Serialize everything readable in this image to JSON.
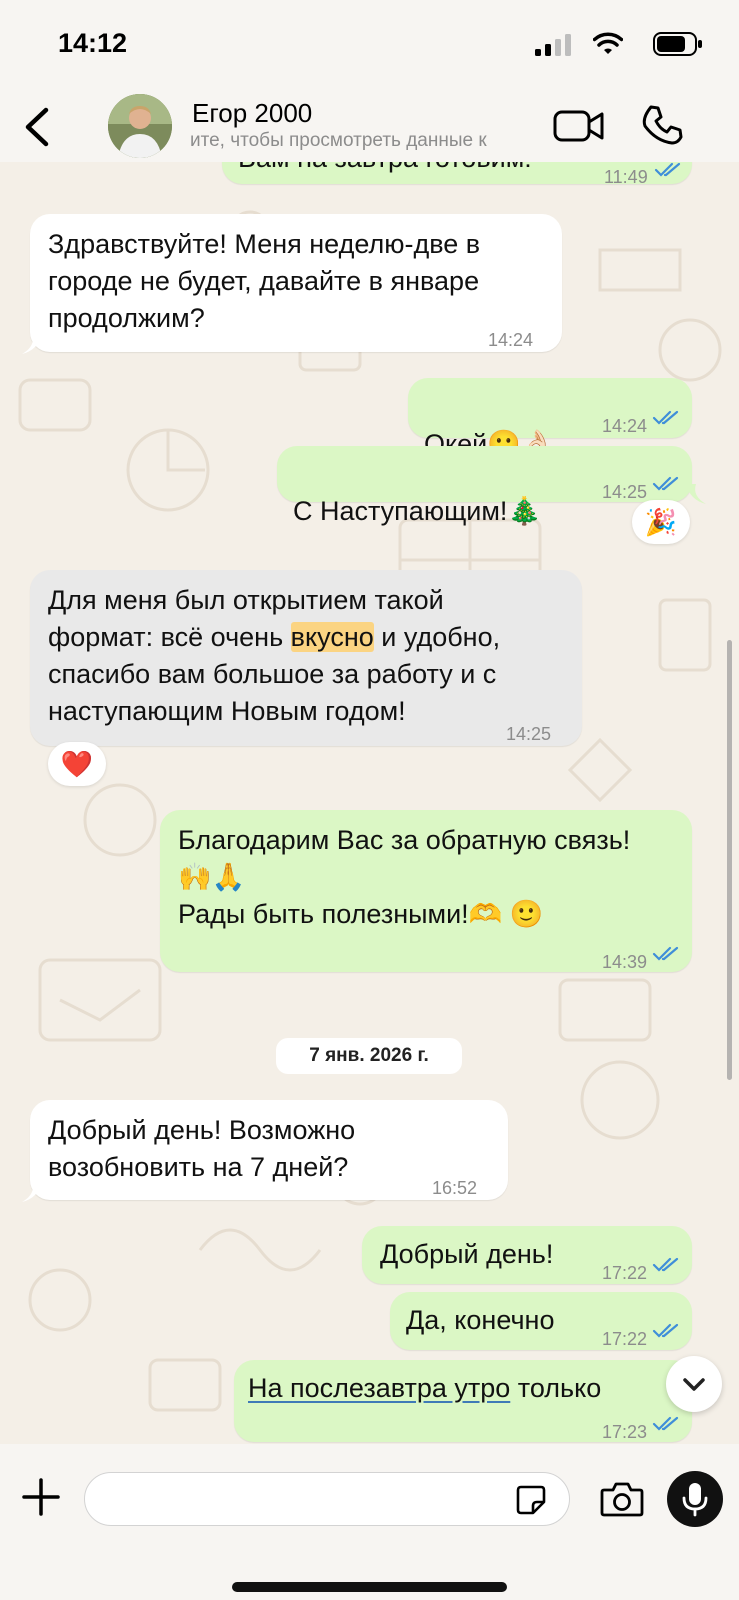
{
  "status_bar": {
    "time": "14:12"
  },
  "header": {
    "contact_name": "Егор 2000",
    "subtitle": "ите, чтобы просмотреть данные к"
  },
  "messages": {
    "m0": {
      "text": "Вам на завтра готовим!",
      "time": "11:49"
    },
    "m1": {
      "text": "Здравствуйте! Меня неделю-две в\nгороде не будет, давайте в январе\nпродолжим?",
      "time": "14:24"
    },
    "m2": {
      "text": "Окей",
      "emoji": "🙂👌🏻",
      "time": "14:24"
    },
    "m3": {
      "text": "С Наступающим!",
      "emoji": "🎄",
      "time": "14:25",
      "reaction": "🎉"
    },
    "m4": {
      "line1": "Для меня был открытием такой",
      "line2_pre": "формат: всё очень ",
      "line2_hl": "вкусно",
      "line2_post": " и удобно,",
      "line3": "спасибо вам большое за работу и с",
      "line4": "наступающим Новым годом!",
      "time": "14:25",
      "reaction": "❤️"
    },
    "m5": {
      "line1": "Благодарим Вас за обратную связь!",
      "line2": "🙌🙏",
      "line3": "Рады быть полезными!🫶 🙂",
      "time": "14:39"
    },
    "date_divider": "7 янв. 2026 г.",
    "m6": {
      "text": "Добрый день! Возможно\nвозобновить на 7 дней?",
      "time": "16:52"
    },
    "m7": {
      "text": "Добрый день!",
      "time": "17:22"
    },
    "m8": {
      "text": "Да, конечно",
      "time": "17:22"
    },
    "m9": {
      "text_ul": "На послезавтра утро",
      "text_rest": " только",
      "time": "17:23"
    }
  },
  "input": {
    "placeholder": ""
  },
  "colors": {
    "incoming_bubble": "#ffffff",
    "outgoing_bubble": "#dbf7c5",
    "read_ticks": "#3f8ed9",
    "highlight": "#fbd482",
    "background": "#f4efe7"
  },
  "icons": {
    "back": "chevron-left-icon",
    "video": "video-camera-icon",
    "call": "phone-icon",
    "attach": "plus-icon",
    "sticker": "sticker-icon",
    "camera": "camera-icon",
    "mic": "microphone-icon",
    "scroll_down": "chevron-down-icon"
  }
}
